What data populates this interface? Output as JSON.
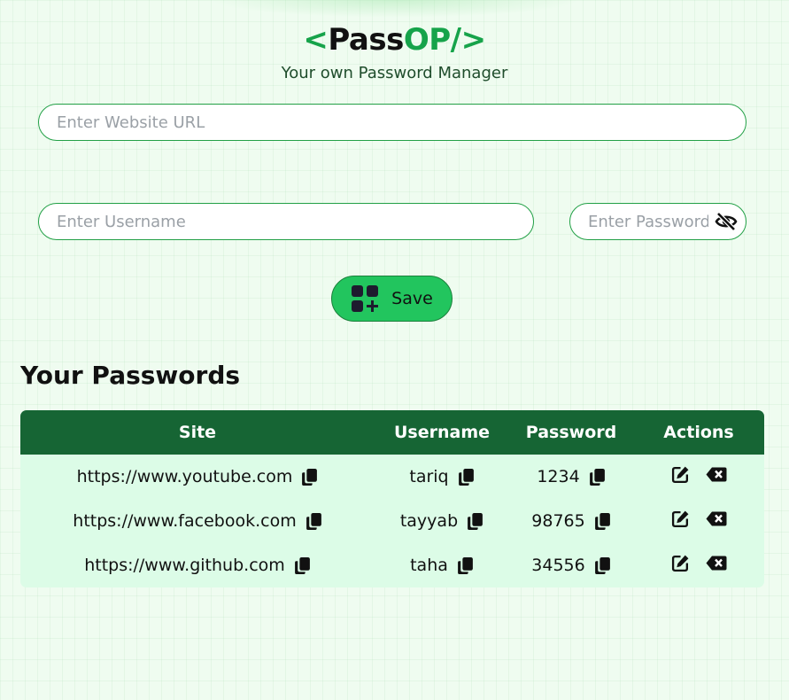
{
  "app": {
    "logo_open": "<",
    "logo_pass": "Pass",
    "logo_op": "OP/",
    "logo_close": ">",
    "subtitle": "Your own Password Manager"
  },
  "form": {
    "url_placeholder": "Enter Website URL",
    "username_placeholder": "Enter Username",
    "password_placeholder": "Enter Password",
    "save_label": "Save"
  },
  "passwords": {
    "title": "Your Passwords",
    "columns": [
      "Site",
      "Username",
      "Password",
      "Actions"
    ],
    "rows": [
      {
        "site": "https://www.youtube.com",
        "username": "tariq",
        "password": "1234"
      },
      {
        "site": "https://www.facebook.com",
        "username": "tayyab",
        "password": "98765"
      },
      {
        "site": "https://www.github.com",
        "username": "taha",
        "password": "34556"
      }
    ]
  },
  "icons": {
    "eye": "eye-slash-icon",
    "save": "add-grid-icon",
    "copy": "copy-icon",
    "edit": "edit-icon",
    "delete": "backspace-delete-icon"
  },
  "colors": {
    "brand_green": "#16a34a",
    "save_button": "#22c55e",
    "table_header": "#166534",
    "table_body": "#dcfce7"
  }
}
